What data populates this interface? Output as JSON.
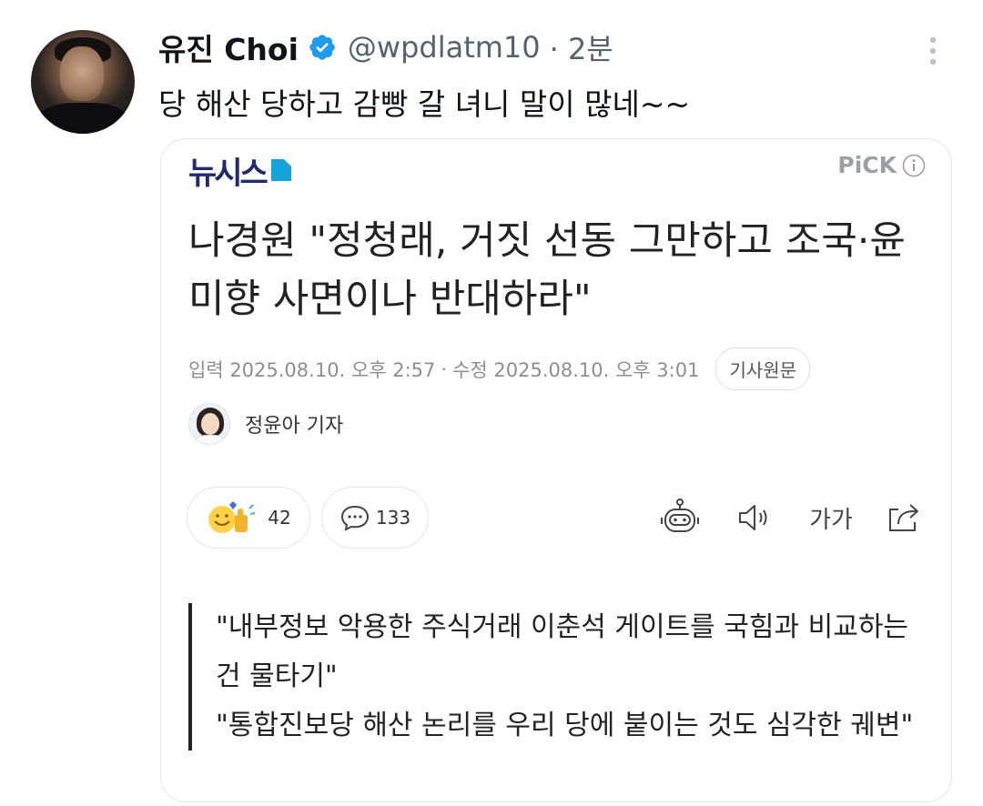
{
  "tweet": {
    "display_name": "유진 Choi",
    "handle": "@wpdlatm10",
    "time": "· 2분",
    "text": "당 해산 당하고 감빵 갈 녀니 말이 많네~~",
    "verified": true,
    "colors": {
      "verified": "#1d9bf0",
      "secondary": "#536471"
    }
  },
  "card": {
    "source": "뉴시스",
    "pick": "PiCK",
    "headline": "나경원 \"정청래, 거짓 선동 그만하고 조국·윤미향 사면이나 반대하라\"",
    "meta": {
      "input": "입력 2025.08.10. 오후 2:57",
      "separator": "·",
      "modified": "수정 2025.08.10. 오후 3:01",
      "original_button": "기사원문"
    },
    "reporter": "정윤아 기자",
    "reactions": {
      "likes": "42",
      "comments": "133"
    },
    "tools": {
      "font_size": "가가"
    },
    "quotes": [
      "\"내부정보 악용한 주식거래 이춘석 게이트를 국힘과 비교하는 건 물타기\"",
      "\"통합진보당 해산 논리를 우리 당에 붙이는 것도 심각한 궤변\""
    ],
    "colors": {
      "logo": "#1f2b6b",
      "logo_mark": "#16a3dd",
      "border": "#e3e6ea"
    }
  }
}
